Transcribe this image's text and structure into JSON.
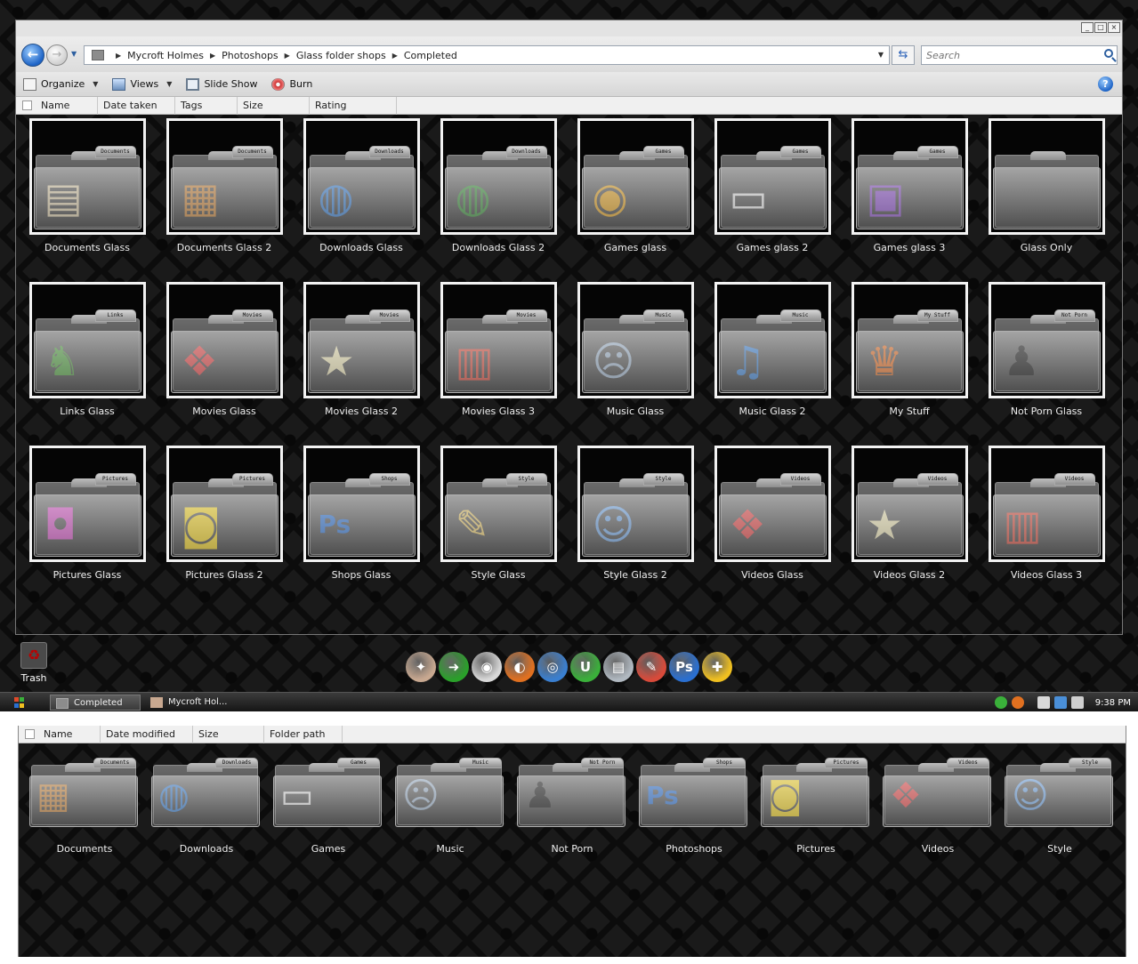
{
  "window": {
    "controls": [
      "_",
      "□",
      "×"
    ]
  },
  "address": {
    "crumbs": [
      "Mycroft Holmes",
      "Photoshops",
      "Glass folder shops",
      "Completed"
    ],
    "search_placeholder": "Search"
  },
  "toolbar": {
    "organize": "Organize",
    "views": "Views",
    "slideshow": "Slide Show",
    "burn": "Burn",
    "help": "?"
  },
  "columns": [
    "Name",
    "Date taken",
    "Tags",
    "Size",
    "Rating"
  ],
  "folders": [
    {
      "label": "Documents Glass",
      "tab": "Documents",
      "icon": "document-stack-icon",
      "glyph": "▤",
      "color": "#d8c9a6"
    },
    {
      "label": "Documents Glass 2",
      "tab": "Documents",
      "icon": "file-cabinet-icon",
      "glyph": "▦",
      "color": "#c8843a"
    },
    {
      "label": "Downloads Glass",
      "tab": "Downloads",
      "icon": "globe-download-icon",
      "glyph": "◍",
      "color": "#3a7fd0"
    },
    {
      "label": "Downloads Glass 2",
      "tab": "Downloads",
      "icon": "globe-download-icon",
      "glyph": "◍",
      "color": "#3a8f3a"
    },
    {
      "label": "Games glass",
      "tab": "Games",
      "icon": "dragon-logo-icon",
      "glyph": "◉",
      "color": "#e0a020"
    },
    {
      "label": "Games glass 2",
      "tab": "Games",
      "icon": "game-console-icon",
      "glyph": "▭",
      "color": "#e6e6e6"
    },
    {
      "label": "Games glass 3",
      "tab": "Games",
      "icon": "arcade-machine-icon",
      "glyph": "▣",
      "color": "#8a4fc8"
    },
    {
      "label": "Glass Only",
      "tab": "",
      "icon": "empty-folder-icon",
      "glyph": "",
      "color": "#cccccc"
    },
    {
      "label": "Links Glass",
      "tab": "Links",
      "icon": "link-characters-icon",
      "glyph": "♞",
      "color": "#4a9a3a"
    },
    {
      "label": "Movies Glass",
      "tab": "Movies",
      "icon": "popcorn-3d-glasses-icon",
      "glyph": "❖",
      "color": "#e04040"
    },
    {
      "label": "Movies Glass 2",
      "tab": "Movies",
      "icon": "star-award-icon",
      "glyph": "★",
      "color": "#e8e0b0"
    },
    {
      "label": "Movies Glass 3",
      "tab": "Movies",
      "icon": "popcorn-machine-icon",
      "glyph": "▥",
      "color": "#d84a3a"
    },
    {
      "label": "Music Glass",
      "tab": "Music",
      "icon": "screaming-face-icon",
      "glyph": "☹",
      "color": "#9ab0c8"
    },
    {
      "label": "Music Glass 2",
      "tab": "Music",
      "icon": "music-disc-icon",
      "glyph": "♫",
      "color": "#3a7fd0"
    },
    {
      "label": "My Stuff",
      "tab": "My Stuff",
      "icon": "armchair-icon",
      "glyph": "♛",
      "color": "#e06a20"
    },
    {
      "label": "Not Porn Glass",
      "tab": "Not Porn",
      "icon": "silhouette-icon",
      "glyph": "♟",
      "color": "#151515"
    },
    {
      "label": "Pictures Glass",
      "tab": "Pictures",
      "icon": "camera-icon",
      "glyph": "◘",
      "color": "#d04fc0"
    },
    {
      "label": "Pictures Glass 2",
      "tab": "Pictures",
      "icon": "disposable-camera-icon",
      "glyph": "◙",
      "color": "#f0d020"
    },
    {
      "label": "Shops Glass",
      "tab": "Shops",
      "icon": "photoshop-paint-can-icon",
      "glyph": "Ps",
      "color": "#2a6fd0"
    },
    {
      "label": "Style Glass",
      "tab": "Style",
      "icon": "brushes-cup-icon",
      "glyph": "✎",
      "color": "#e0c060"
    },
    {
      "label": "Style Glass 2",
      "tab": "Style",
      "icon": "lego-painter-icon",
      "glyph": "☺",
      "color": "#6aa0e0"
    },
    {
      "label": "Videos Glass",
      "tab": "Videos",
      "icon": "popcorn-3d-glasses-icon",
      "glyph": "❖",
      "color": "#e04040"
    },
    {
      "label": "Videos Glass 2",
      "tab": "Videos",
      "icon": "star-award-icon",
      "glyph": "★",
      "color": "#e8e0b0"
    },
    {
      "label": "Videos Glass 3",
      "tab": "Videos",
      "icon": "popcorn-machine-icon",
      "glyph": "▥",
      "color": "#d84a3a"
    }
  ],
  "desktop": {
    "trash_label": "Trash"
  },
  "dock": [
    {
      "name": "mouse-dock-icon",
      "color": "#c8a890",
      "glyph": "✦"
    },
    {
      "name": "green-arrow-dock-icon",
      "color": "#2aa02a",
      "glyph": "➜"
    },
    {
      "name": "chrome-dock-icon",
      "color": "#d8d8d8",
      "glyph": "◉"
    },
    {
      "name": "firefox-dock-icon",
      "color": "#e07020",
      "glyph": "◐"
    },
    {
      "name": "media-player-dock-icon",
      "color": "#3a7fd0",
      "glyph": "◎"
    },
    {
      "name": "utorrent-dock-icon",
      "color": "#3ab03a",
      "glyph": "U"
    },
    {
      "name": "printer-dock-icon",
      "color": "#b0b8c0",
      "glyph": "▤"
    },
    {
      "name": "paint-tool-dock-icon",
      "color": "#d84a3a",
      "glyph": "✎"
    },
    {
      "name": "photoshop-dock-icon",
      "color": "#2a6fd0",
      "glyph": "Ps"
    },
    {
      "name": "psp-dock-icon",
      "color": "#f0c020",
      "glyph": "✚"
    }
  ],
  "taskbar": {
    "task_active": "Completed",
    "task_2": "Mycroft Hol...",
    "clock": "9:38 PM"
  },
  "bottom_panel": {
    "columns": [
      "Name",
      "Date modified",
      "Size",
      "Folder path"
    ],
    "folders": [
      {
        "label": "Documents",
        "tab": "Documents",
        "icon": "file-cabinet-icon",
        "glyph": "▦",
        "color": "#c8843a"
      },
      {
        "label": "Downloads",
        "tab": "Downloads",
        "icon": "globe-download-icon",
        "glyph": "◍",
        "color": "#3a7fd0"
      },
      {
        "label": "Games",
        "tab": "Games",
        "icon": "game-console-icon",
        "glyph": "▭",
        "color": "#e6e6e6"
      },
      {
        "label": "Music",
        "tab": "Music",
        "icon": "screaming-face-icon",
        "glyph": "☹",
        "color": "#9ab0c8"
      },
      {
        "label": "Not Porn",
        "tab": "Not Porn",
        "icon": "silhouette-icon",
        "glyph": "♟",
        "color": "#151515"
      },
      {
        "label": "Photoshops",
        "tab": "Shops",
        "icon": "photoshop-paint-can-icon",
        "glyph": "Ps",
        "color": "#2a6fd0"
      },
      {
        "label": "Pictures",
        "tab": "Pictures",
        "icon": "disposable-camera-icon",
        "glyph": "◙",
        "color": "#f0d020"
      },
      {
        "label": "Videos",
        "tab": "Videos",
        "icon": "popcorn-3d-glasses-icon",
        "glyph": "❖",
        "color": "#e04040"
      },
      {
        "label": "Style",
        "tab": "Style",
        "icon": "lego-painter-icon",
        "glyph": "☺",
        "color": "#6aa0e0"
      }
    ]
  }
}
